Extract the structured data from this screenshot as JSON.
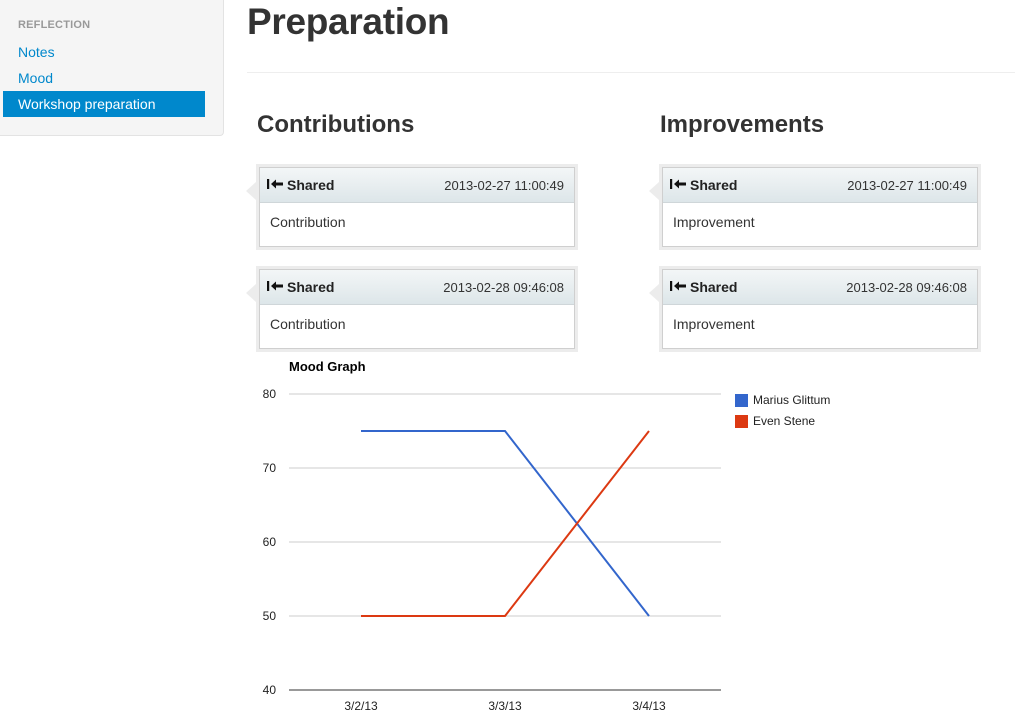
{
  "sidebar": {
    "header": "REFLECTION",
    "items": [
      {
        "label": "Notes",
        "active": false
      },
      {
        "label": "Mood",
        "active": false
      },
      {
        "label": "Workshop preparation",
        "active": true
      }
    ]
  },
  "page": {
    "title": "Preparation"
  },
  "contributions": {
    "title": "Contributions",
    "cards": [
      {
        "status": "Shared",
        "timestamp": "2013-02-27 11:00:49",
        "text": "Contribution",
        "icon": "share-arrow-icon"
      },
      {
        "status": "Shared",
        "timestamp": "2013-02-28 09:46:08",
        "text": "Contribution",
        "icon": "share-arrow-icon"
      }
    ]
  },
  "improvements": {
    "title": "Improvements",
    "cards": [
      {
        "status": "Shared",
        "timestamp": "2013-02-27 11:00:49",
        "text": "Improvement",
        "icon": "share-arrow-icon"
      },
      {
        "status": "Shared",
        "timestamp": "2013-02-28 09:46:08",
        "text": "Improvement",
        "icon": "share-arrow-icon"
      }
    ]
  },
  "colors": {
    "accent": "#0088cc",
    "series1": "#3366cc",
    "series2": "#dc3912"
  },
  "chart_data": {
    "type": "line",
    "title": "Mood Graph",
    "categories": [
      "3/2/13",
      "3/3/13",
      "3/4/13"
    ],
    "series": [
      {
        "name": "Marius Glittum",
        "values": [
          75,
          75,
          50
        ],
        "color": "#3366cc"
      },
      {
        "name": "Even Stene",
        "values": [
          50,
          50,
          75
        ],
        "color": "#dc3912"
      }
    ],
    "yticks": [
      40,
      50,
      60,
      70,
      80
    ],
    "ylim": [
      40,
      80
    ],
    "grid": true,
    "legend": "right"
  }
}
